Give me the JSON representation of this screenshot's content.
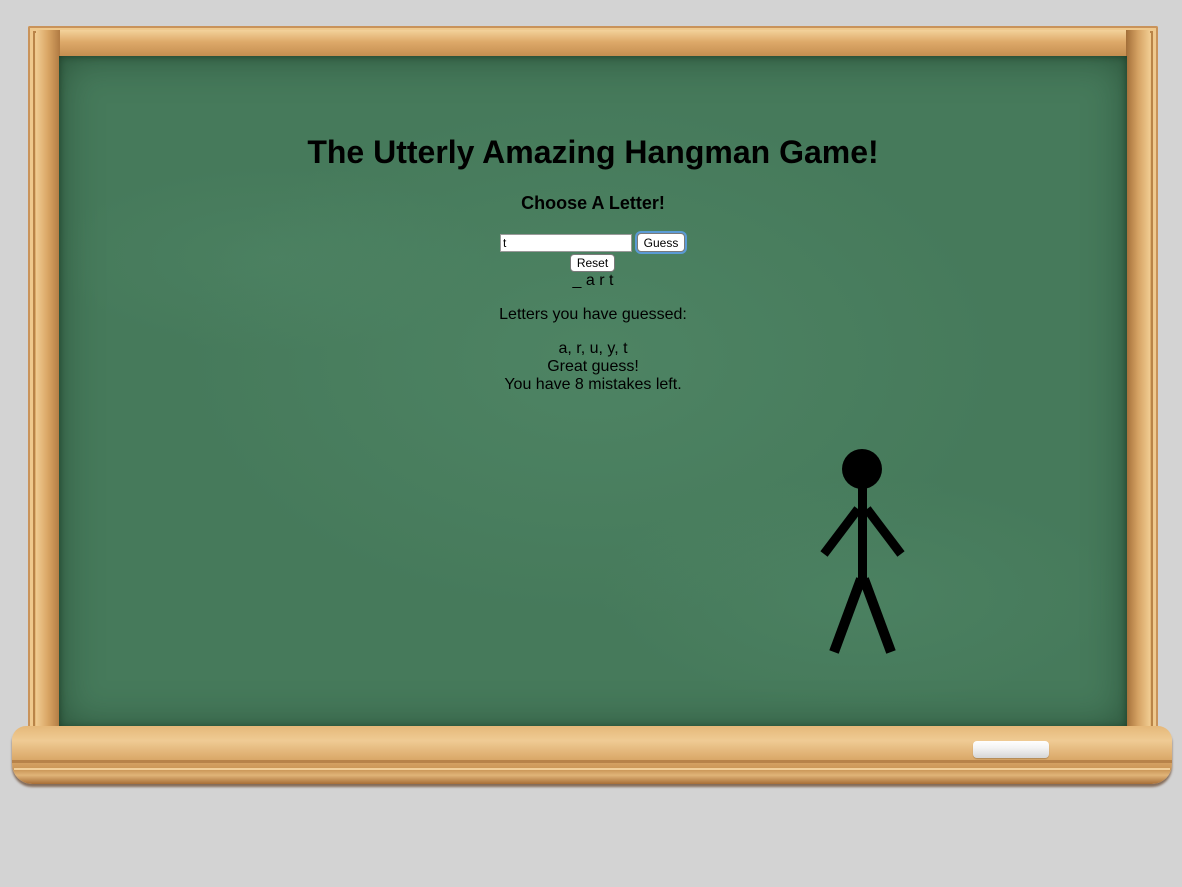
{
  "game": {
    "title": "The Utterly Amazing Hangman Game!",
    "subtitle": "Choose A Letter!",
    "input_value": "t",
    "guess_label": "Guess",
    "reset_label": "Reset",
    "word_display": "_ a r t",
    "guessed_label": "Letters you have guessed:",
    "guessed_letters": "a, r, u, y, t",
    "message": "Great guess!",
    "mistakes_text": "You have 8 mistakes left."
  },
  "colors": {
    "chalkboard": "#467a5b",
    "frame_wood": "#e0b074",
    "background": "#d3d3d3",
    "stickman": "#000000"
  }
}
